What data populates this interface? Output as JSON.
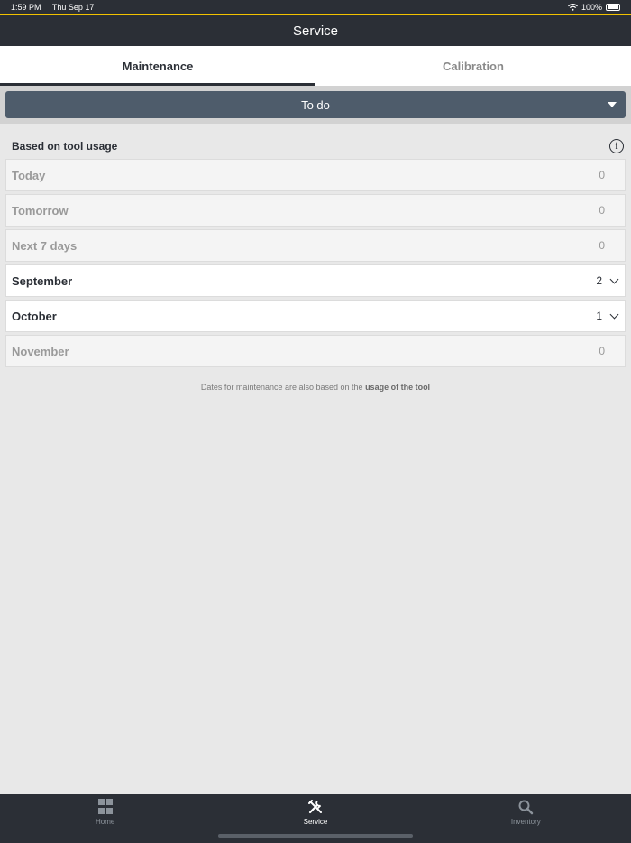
{
  "status_bar": {
    "time": "1:59 PM",
    "date": "Thu Sep 17",
    "battery": "100%"
  },
  "nav": {
    "title": "Service"
  },
  "tabs": [
    {
      "label": "Maintenance",
      "active": true
    },
    {
      "label": "Calibration",
      "active": false
    }
  ],
  "filter": {
    "selected": "To do"
  },
  "section": {
    "title": "Based on tool usage"
  },
  "rows": [
    {
      "label": "Today",
      "count": "0"
    },
    {
      "label": "Tomorrow",
      "count": "0"
    },
    {
      "label": "Next 7 days",
      "count": "0"
    },
    {
      "label": "September",
      "count": "2"
    },
    {
      "label": "October",
      "count": "1"
    },
    {
      "label": "November",
      "count": "0"
    }
  ],
  "footnote": {
    "text": "Dates for maintenance are also based on the",
    "bold": "usage of the tool"
  },
  "tab_bar": [
    {
      "label": "Home",
      "icon": "grid-icon"
    },
    {
      "label": "Service",
      "icon": "tools-icon"
    },
    {
      "label": "Inventory",
      "icon": "search-icon"
    }
  ],
  "colors": {
    "header": "#2b2f36",
    "accent": "#f2c200",
    "dropdown": "#4e5c6b"
  }
}
